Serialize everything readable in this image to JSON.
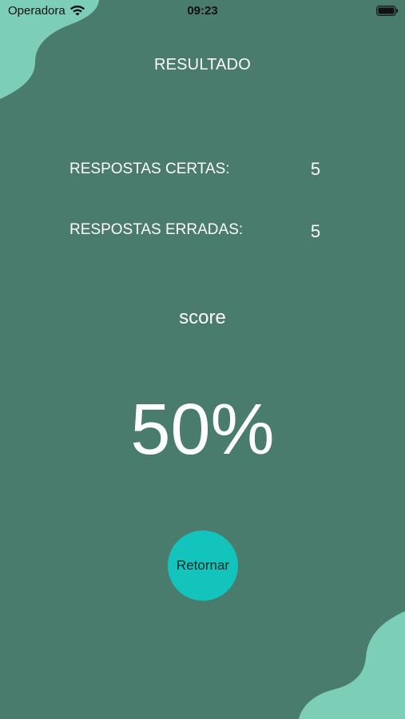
{
  "status_bar": {
    "carrier": "Operadora",
    "time": "09:23",
    "wifi_icon": "wifi-icon",
    "battery_icon": "battery-icon"
  },
  "result": {
    "title": "RESULTADO",
    "correct_label": "RESPOSTAS CERTAS:",
    "correct_value": "5",
    "wrong_label": "RESPOSTAS ERRADAS:",
    "wrong_value": "5",
    "score_label": "score",
    "score_value": "50%"
  },
  "actions": {
    "return_label": "Retornar"
  },
  "colors": {
    "background": "#4a7c6d",
    "blob": "#7ccfb6",
    "button": "#12c4bc",
    "text": "#ffffff"
  }
}
